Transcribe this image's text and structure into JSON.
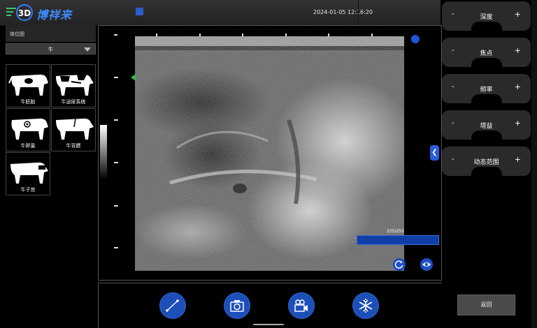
{
  "header": {
    "logo_mark": "3D",
    "brand": "博祥来",
    "datetime": "2024-01-05 12:16:20"
  },
  "left_panel": {
    "title": "体位图",
    "animal_select": "牛",
    "presets": [
      {
        "label": "牛胚胎"
      },
      {
        "label": "牛泌尿系统"
      },
      {
        "label": "牛卵巢"
      },
      {
        "label": "牛背膘"
      },
      {
        "label": "牛子宫"
      }
    ]
  },
  "image_area": {
    "counter": "255/255",
    "progress": 1.0
  },
  "bottom_actions": [
    {
      "icon": "measure-icon"
    },
    {
      "icon": "camera-icon"
    },
    {
      "icon": "video-record-icon"
    },
    {
      "icon": "freeze-snowflake-icon"
    }
  ],
  "right_panel": {
    "params": [
      {
        "name": "深度",
        "minus": "-",
        "plus": "+"
      },
      {
        "name": "焦点",
        "minus": "-",
        "plus": "+"
      },
      {
        "name": "频率",
        "minus": "-",
        "plus": "+"
      },
      {
        "name": "增益",
        "minus": "-",
        "plus": "+"
      },
      {
        "name": "动态范围",
        "minus": "-",
        "plus": "+"
      }
    ],
    "back_label": "返回"
  },
  "colors": {
    "accent_blue": "#1d4fb8",
    "menu_green": "#3cc86a",
    "marker_green": "#2dbb3b"
  }
}
